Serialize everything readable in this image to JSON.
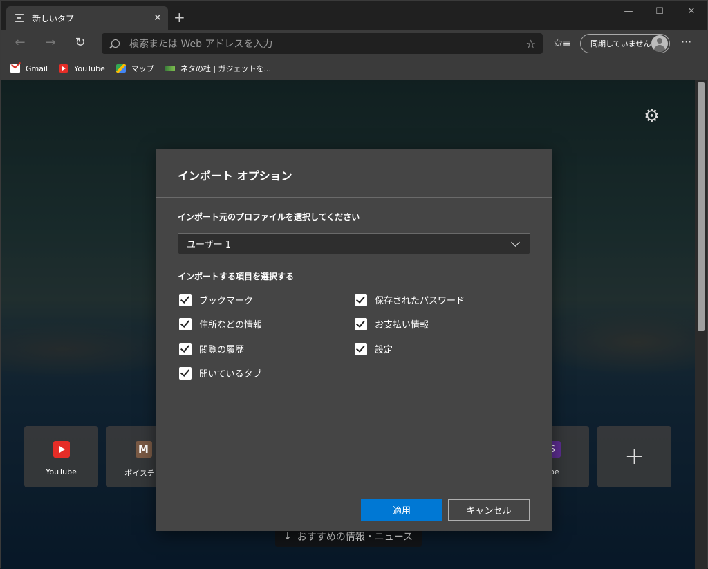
{
  "tab": {
    "title": "新しいタブ",
    "close": "✕",
    "new_tab": "+"
  },
  "window_controls": {
    "minimize": "—",
    "maximize": "☐",
    "close": "✕"
  },
  "nav": {
    "back": "←",
    "forward": "→",
    "refresh": "↻"
  },
  "address_bar": {
    "placeholder": "検索または Web アドレスを入力"
  },
  "toolbar": {
    "favorite": "☆",
    "favorites_list": "✩≡",
    "sync_label": "同期していません",
    "more": "···"
  },
  "bookmarks": [
    {
      "label": "Gmail"
    },
    {
      "label": "YouTube"
    },
    {
      "label": "マップ"
    },
    {
      "label": "ネタの杜 | ガジェットを..."
    }
  ],
  "new_tab_page": {
    "settings": "⚙",
    "tiles": [
      {
        "label": "YouTube"
      },
      {
        "label": "ボイスチェ",
        "icon_letter": "M"
      },
      {
        "label": "ype",
        "icon_letter": "S"
      },
      {
        "label": "+"
      }
    ],
    "news_button": "おすすめの情報・ニュース",
    "news_arrow": "↓"
  },
  "dialog": {
    "title": "インポート オプション",
    "profile_label": "インポート元のプロファイルを選択してください",
    "profile_value": "ユーザー 1",
    "items_label": "インポートする項目を選択する",
    "items": [
      {
        "label": "ブックマーク",
        "checked": true
      },
      {
        "label": "保存されたパスワード",
        "checked": true
      },
      {
        "label": "住所などの情報",
        "checked": true
      },
      {
        "label": "お支払い情報",
        "checked": true
      },
      {
        "label": "閲覧の履歴",
        "checked": true
      },
      {
        "label": "設定",
        "checked": true
      },
      {
        "label": "開いているタブ",
        "checked": true
      }
    ],
    "apply": "適用",
    "cancel": "キャンセル"
  },
  "colors": {
    "accent": "#0078d4",
    "dialog_bg": "#454545",
    "chrome_bg": "#3b3b3b"
  }
}
